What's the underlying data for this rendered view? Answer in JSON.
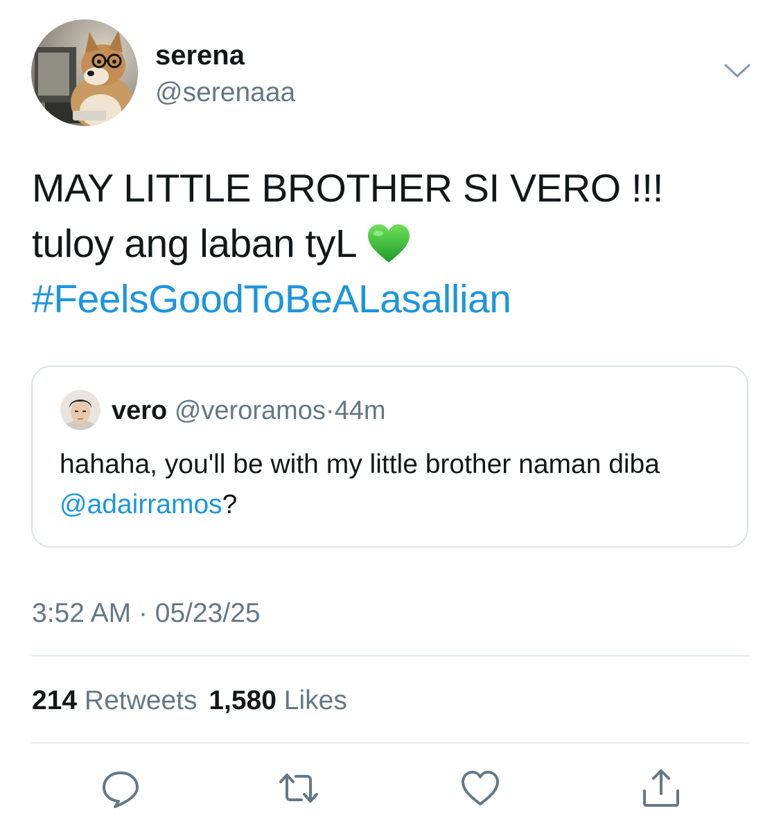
{
  "tweet": {
    "author": {
      "display_name": "serena",
      "handle": "@serenaaa",
      "avatar_icon": "dog-with-glasses-avatar"
    },
    "text_lines": [
      "MAY LITTLE BROTHER SI VERO !!!",
      "tuloy ang laban tyL"
    ],
    "emoji": "green-heart-emoji",
    "hashtag": "#FeelsGoodToBeALasallian",
    "quoted_tweet": {
      "author_name": "vero",
      "handle": "@veroramos",
      "separator": "·",
      "time_ago": "44m",
      "text": "hahaha, you'll be with my little brother naman diba ",
      "mention": "@adairramos",
      "text_end": "?"
    },
    "timestamp": {
      "time": "3:52 AM",
      "separator": "·",
      "date": "05/23/25"
    },
    "stats": {
      "retweets_count": "214",
      "retweets_label": "Retweets",
      "likes_count": "1,580",
      "likes_label": "Likes"
    },
    "actions": [
      {
        "name": "reply",
        "icon": "reply-icon"
      },
      {
        "name": "retweet",
        "icon": "retweet-icon"
      },
      {
        "name": "like",
        "icon": "heart-icon"
      },
      {
        "name": "share",
        "icon": "share-icon"
      }
    ]
  },
  "colors": {
    "text": "#14171a",
    "secondary": "#657786",
    "link": "#1b95e0",
    "border": "#dbe2e8",
    "heart_emoji": "#3fbf3a"
  }
}
